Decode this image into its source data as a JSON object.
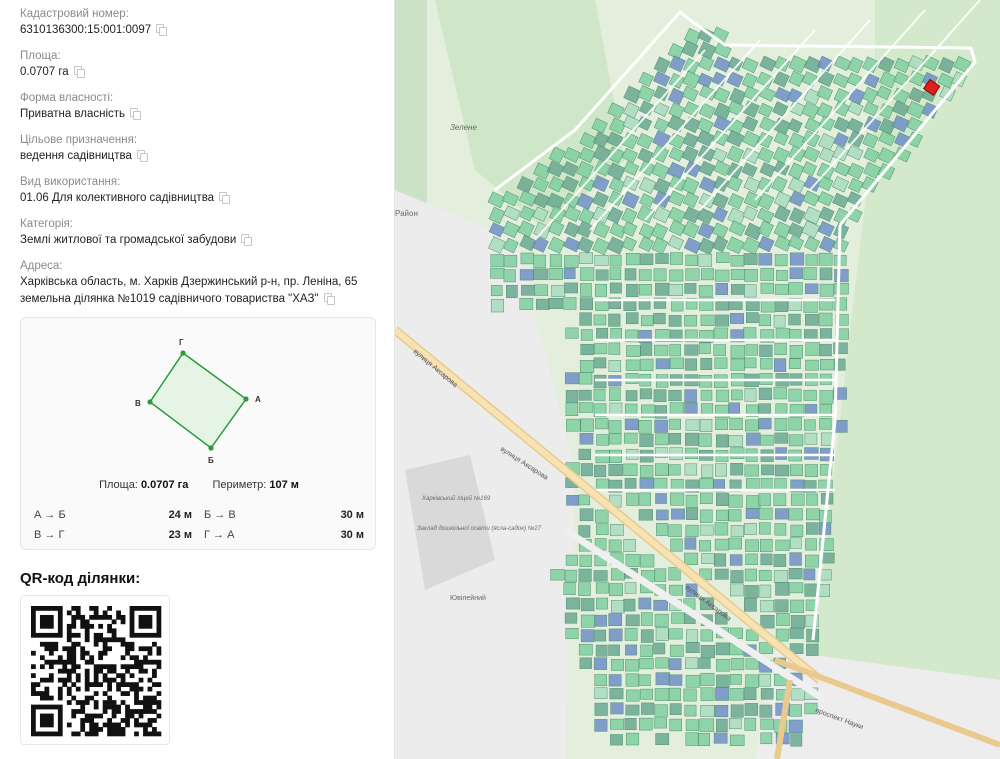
{
  "info": {
    "cadastral": {
      "label": "Кадастровий номер:",
      "value": "6310136300:15:001:0097"
    },
    "area": {
      "label": "Площа:",
      "value": "0.0707 га"
    },
    "ownership": {
      "label": "Форма власності:",
      "value": "Приватна власність"
    },
    "purpose": {
      "label": "Цільове призначення:",
      "value": "ведення садівництва"
    },
    "usage": {
      "label": "Вид використання:",
      "value": "01.06 Для колективного садівництва"
    },
    "category": {
      "label": "Категорія:",
      "value": "Землі житлової та громадської забудови"
    },
    "address": {
      "label": "Адреса:",
      "line1": "Харківська область, м. Харків Дзержинський р-н, пр. Леніна, 65",
      "line2": "земельна ділянка №1019 садівничого товариства \"ХАЗ\""
    }
  },
  "geometry": {
    "vertices": {
      "g": "Г",
      "a": "А",
      "b": "Б",
      "v": "В"
    },
    "area_label": "Площа:",
    "area_value": "0.0707 га",
    "perimeter_label": "Периметр:",
    "perimeter_value": "107 м",
    "sides": [
      {
        "name": "А → Б",
        "length": "24 м"
      },
      {
        "name": "Б → В",
        "length": "30 м"
      },
      {
        "name": "В → Г",
        "length": "23 м"
      },
      {
        "name": "Г → А",
        "length": "30 м"
      }
    ],
    "colors": {
      "stroke": "#2a9a3a",
      "fill": "#e6f4e6"
    }
  },
  "qr": {
    "title": "QR-код ділянки:"
  },
  "map": {
    "labels": {
      "zelene": "Зелене",
      "street_aksarova_1": "вулиця Аксарова",
      "street_aksarova_2": "вулиця Аксарова",
      "street_aksarova_3": "вулиця Аксарова",
      "lyceum": "Харківський ліцей №169",
      "kindergarten": "Заклад дошкільної освіти (ясла-садок) №27",
      "yuvileinyi": "Ювілейний",
      "rayon": "Район",
      "street_nauky": "проспект Науки"
    },
    "colors": {
      "plot": "#7fcf9f",
      "plot_dark": "#6aa890",
      "plot_blue": "#6f8fc6",
      "selected": "#e0201c",
      "forest": "#d6ead0"
    }
  }
}
